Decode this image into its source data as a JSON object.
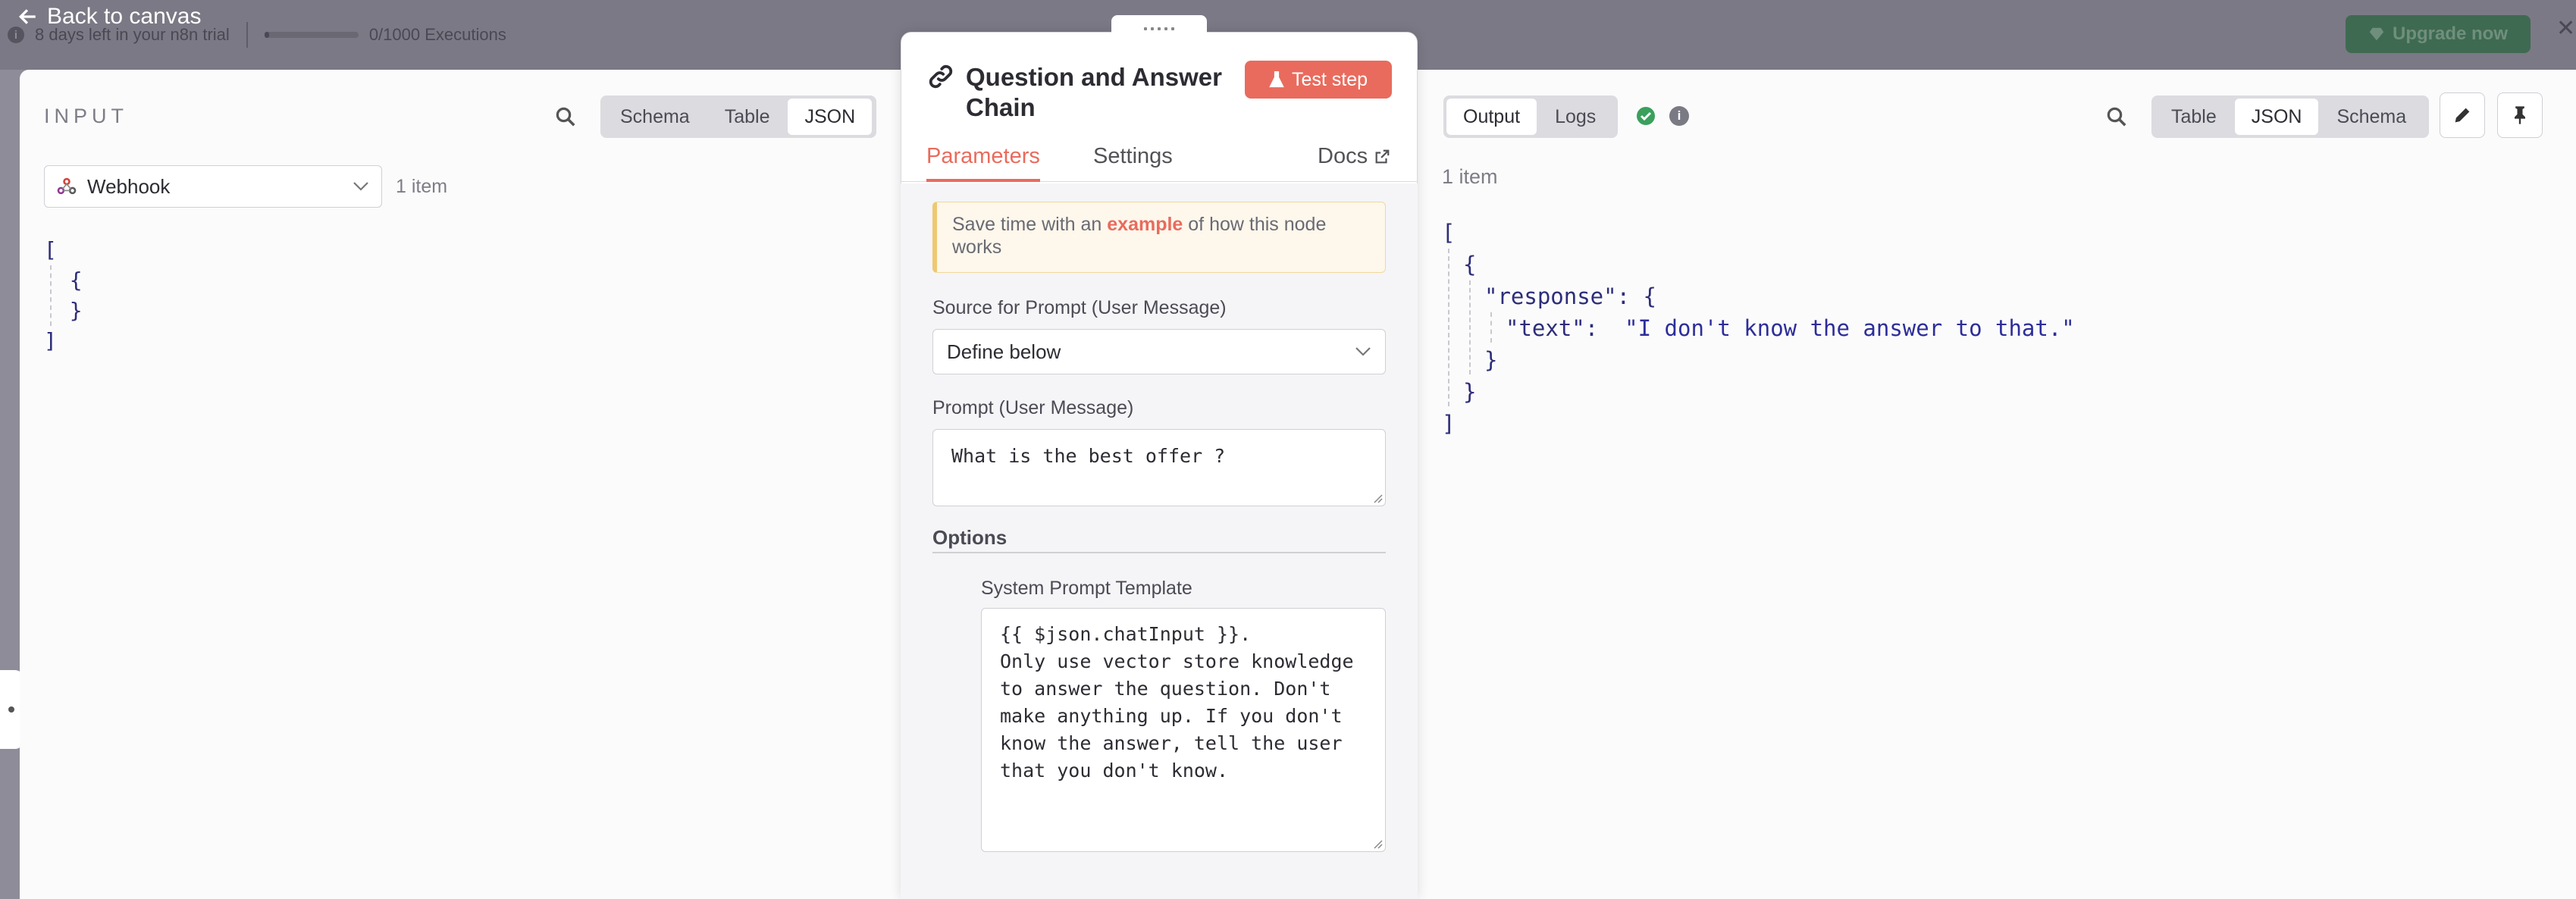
{
  "background": {
    "trial_text": "8 days left in your n8n trial",
    "executions": "0/1000 Executions",
    "executions_used": 0,
    "upgrade_label": "Upgrade now"
  },
  "back_label": "Back to canvas",
  "input": {
    "title": "INPUT",
    "view_options": [
      "Schema",
      "Table",
      "JSON"
    ],
    "active_view": "JSON",
    "source_node": "Webhook",
    "item_count": "1 item",
    "json_lines": [
      "[",
      "  {",
      "  }",
      "]"
    ]
  },
  "node": {
    "title": "Question and Answer Chain",
    "test_label": "Test step",
    "tabs": {
      "parameters": "Parameters",
      "settings": "Settings",
      "docs": "Docs"
    },
    "hint": {
      "before": "Save time with an ",
      "link": "example",
      "after": " of how this node works"
    },
    "source_label": "Source for Prompt (User Message)",
    "source_value": "Define below",
    "prompt_label": "Prompt (User Message)",
    "prompt_value": "What is the best offer ?",
    "options_label": "Options",
    "system_label": "System Prompt Template",
    "system_value": "{{ $json.chatInput }}.\nOnly use vector store knowledge\nto answer the question. Don't\nmake anything up. If you don't\nknow the answer, tell the user\nthat you don't know."
  },
  "output": {
    "tabs": [
      "Output",
      "Logs"
    ],
    "active_tab": "Output",
    "view_options": [
      "Table",
      "JSON",
      "Schema"
    ],
    "active_view": "JSON",
    "item_count": "1 item",
    "json": {
      "open": "[",
      "obj_open": "{",
      "response_key": "\"response\": {",
      "text_key": "\"text\":",
      "text_value": "\"I don't know the answer to that.\"",
      "inner_close": "}",
      "obj_close": "}",
      "close": "]"
    }
  },
  "colors": {
    "accent": "#e96b5d",
    "success": "#3aa05c",
    "json_text": "#2d2d7a"
  }
}
